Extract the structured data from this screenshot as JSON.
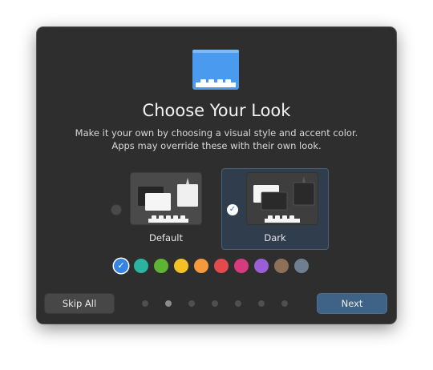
{
  "dialog": {
    "title": "Choose Your Look",
    "description_lines": [
      "Make it your own by choosing a visual style and accent color.",
      "Apps may override these with their own look."
    ]
  },
  "styles": [
    {
      "label": "Default",
      "selected": false
    },
    {
      "label": "Dark",
      "selected": true
    }
  ],
  "accent_colors": [
    {
      "name": "blue",
      "color": "#3584e4",
      "selected": true
    },
    {
      "name": "teal",
      "color": "#2bb3a0",
      "selected": false
    },
    {
      "name": "green",
      "color": "#5fb334",
      "selected": false
    },
    {
      "name": "yellow",
      "color": "#f5c025",
      "selected": false
    },
    {
      "name": "orange",
      "color": "#f49a3d",
      "selected": false
    },
    {
      "name": "red",
      "color": "#e34a4d",
      "selected": false
    },
    {
      "name": "pink",
      "color": "#d63b7d",
      "selected": false
    },
    {
      "name": "purple",
      "color": "#9a5fd6",
      "selected": false
    },
    {
      "name": "brown",
      "color": "#8e7059",
      "selected": false
    },
    {
      "name": "slate",
      "color": "#6f7f8f",
      "selected": false
    }
  ],
  "pagination": {
    "total": 7,
    "current": 2
  },
  "buttons": {
    "skip_label": "Skip All",
    "next_label": "Next"
  },
  "icons": {
    "app": "dock-icon",
    "check": "check-icon"
  }
}
